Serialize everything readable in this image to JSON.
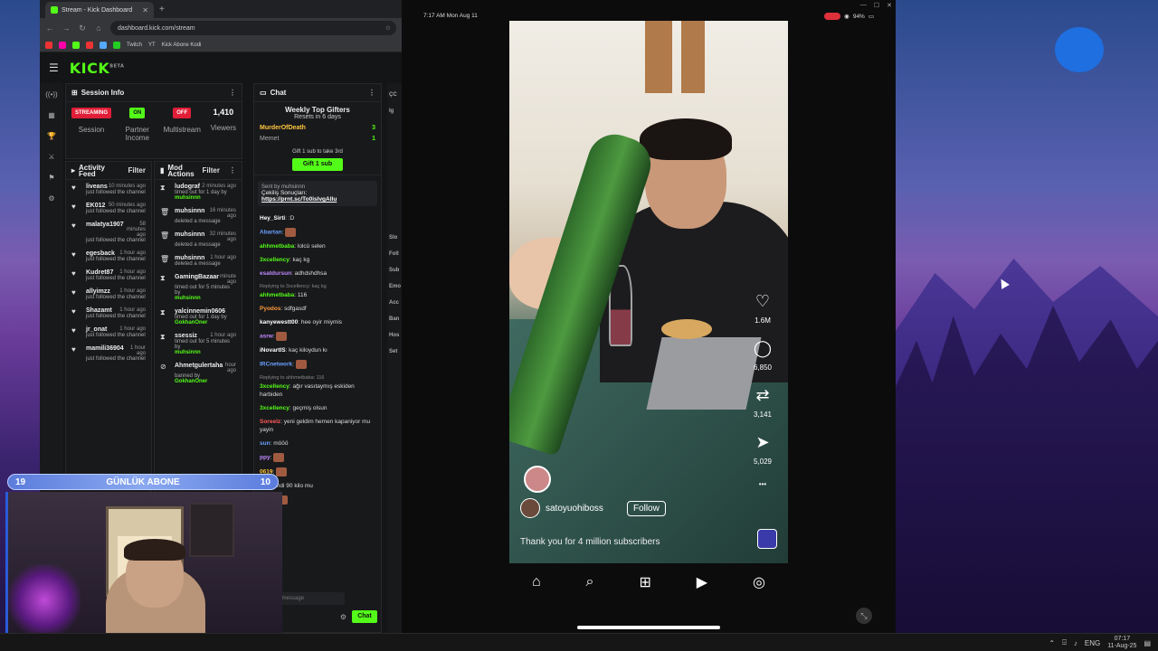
{
  "browser": {
    "tab_title": "Stream - Kick Dashboard",
    "url": "dashboard.kick.com/stream",
    "bookmarks": [
      "Twitch",
      "YT",
      "Kick Abone Kodi"
    ]
  },
  "kick": {
    "logo": "KICK",
    "logo_sup": "BETA",
    "session": {
      "title": "Session Info",
      "streaming": "STREAMING",
      "session_label": "Session",
      "partner_badge": "ON",
      "partner_label": "Partner Income",
      "multistream_badge": "OFF",
      "multistream_label": "Multistream",
      "viewers_count": "1,410",
      "viewers_label": "Viewers"
    },
    "activity": {
      "title": "Activity Feed",
      "filter": "Filter",
      "items": [
        {
          "name": "liveans",
          "time": "10 minutes ago",
          "text": "just followed the channel"
        },
        {
          "name": "EK012",
          "time": "50 minutes ago",
          "text": "just followed the channel"
        },
        {
          "name": "malatya1907",
          "time": "58 minutes ago",
          "text": "just followed the channel"
        },
        {
          "name": "egesback",
          "time": "1 hour ago",
          "text": "just followed the channel"
        },
        {
          "name": "Kudret87",
          "time": "1 hour ago",
          "text": "just followed the channel"
        },
        {
          "name": "allyimzz",
          "time": "1 hour ago",
          "text": "just followed the channel"
        },
        {
          "name": "Shazamt",
          "time": "1 hour ago",
          "text": "just followed the channel"
        },
        {
          "name": "jr_onat",
          "time": "1 hour ago",
          "text": "just followed the channel"
        },
        {
          "name": "mamili36904",
          "time": "1 hour ago",
          "text": "just followed the channel"
        }
      ]
    },
    "mod": {
      "title": "Mod Actions",
      "filter": "Filter",
      "items": [
        {
          "icon": "⧗",
          "name": "ludograf",
          "time": "2 minutes ago",
          "text": "timed out for 1 day by",
          "by": "muhsinnn"
        },
        {
          "icon": "🗑",
          "name": "muhsinnn",
          "time": "16 minutes ago",
          "text": "deleted a message",
          "by": ""
        },
        {
          "icon": "🗑",
          "name": "muhsinnn",
          "time": "32 minutes ago",
          "text": "deleted a message",
          "by": ""
        },
        {
          "icon": "🗑",
          "name": "muhsinnn",
          "time": "1 hour ago",
          "text": "deleted a message",
          "by": ""
        },
        {
          "icon": "⧗",
          "name": "GamingBazaar",
          "time": "minute ago",
          "text": "timed out for 5 minutes by",
          "by": "muhsinnn"
        },
        {
          "icon": "⧗",
          "name": "yalcinnemin0606",
          "time": "",
          "text": "timed out for 1 day by",
          "by": "GokhanOner"
        },
        {
          "icon": "⧗",
          "name": "ssessiz",
          "time": "1 hour ago",
          "text": "timed out for 5 minutes by",
          "by": "muhsinnn"
        },
        {
          "icon": "⊘",
          "name": "Ahmetgulertaha",
          "time": "hour ago",
          "text": "banned by",
          "by": "GokhanOner"
        }
      ]
    },
    "chat": {
      "title": "Chat",
      "gifters_title": "Weekly Top Gifters",
      "gifters_sub": "Resets in 6 days",
      "gifter1": "MurderOfDeath",
      "gifter1_count": "3",
      "gifter2": "Memet",
      "gifter2_count": "1",
      "gift_cta": "Gift 1 sub to take 3rd",
      "gift_btn": "Gift 1 sub",
      "pinned_by": "Sent by muhsinnn",
      "pinned_text": "Çekiliş Sonuçları:",
      "pinned_link": "https://prnt.sc/To0islvgAllu",
      "input_placeholder": "Send a message",
      "send": "Chat",
      "messages": [
        {
          "user": "Hey_Sirti",
          "color": "#ffffff",
          "text": ":D",
          "reply": ""
        },
        {
          "user": "Abartan",
          "color": "#6aa0ff",
          "text": "",
          "reply": ""
        },
        {
          "user": "ahhmetbaba",
          "color": "#53fc18",
          "text": "lolcü selen",
          "reply": ""
        },
        {
          "user": "3xcellency",
          "color": "#53fc18",
          "text": "kaç kg",
          "reply": ""
        },
        {
          "user": "esatdursun",
          "color": "#c08aff",
          "text": "adhdshdhsa",
          "reply": ""
        },
        {
          "user": "ahhmetbaba",
          "color": "#53fc18",
          "text": "116",
          "reply": "Replying to 3xcellency: kaç kg"
        },
        {
          "user": "Pyodos",
          "color": "#ff9a3c",
          "text": "sdfgasdf",
          "reply": ""
        },
        {
          "user": "kanyewestt00",
          "color": "#ffffff",
          "text": "hee oyir miymis",
          "reply": ""
        },
        {
          "user": "asrw",
          "color": "#c08aff",
          "text": "",
          "reply": ""
        },
        {
          "user": "iNovartIS",
          "color": "#ffffff",
          "text": "kaç kiloydun kı",
          "reply": ""
        },
        {
          "user": "IRCnetwork",
          "color": "#6aa0ff",
          "text": "",
          "reply": ""
        },
        {
          "user": "3xcellency",
          "color": "#53fc18",
          "text": "ağır vasıtaymış eskiden harbiden",
          "reply": "Replying to ahhmetbaba: 116"
        },
        {
          "user": "3xcellency",
          "color": "#53fc18",
          "text": "geçmiş olsun",
          "reply": ""
        },
        {
          "user": "Soreelz",
          "color": "#ff5a5a",
          "text": "yeni geldim hemen kapaniyor mu yayin",
          "reply": ""
        },
        {
          "user": "sun",
          "color": "#6aa0ff",
          "text": "mööö",
          "reply": ""
        },
        {
          "user": "ppy",
          "color": "#c08aff",
          "text": "",
          "reply": ""
        },
        {
          "user": "0619",
          "color": "#ffc53d",
          "text": "",
          "reply": ""
        },
        {
          "user": "na",
          "color": "#6aa0ff",
          "text": "Şimdi 90 kilo mu",
          "reply": ""
        },
        {
          "user": "work",
          "color": "#ffc53d",
          "text": "",
          "reply": ""
        },
        {
          "user": "",
          "color": "#aaaaaa",
          "text": "s only",
          "reply": ""
        }
      ]
    },
    "right_col": [
      "ÇC",
      "Ig",
      "Slo",
      "Foll",
      "Sub",
      "Emo",
      "Acc",
      "Ban",
      "Hos",
      "Set"
    ]
  },
  "overlay": {
    "sub_goal_left": "19",
    "sub_goal_label": "GÜNLÜK ABONE",
    "sub_goal_right": "10"
  },
  "phone": {
    "time": "7:17 AM  Mon Aug 11",
    "battery": "94%",
    "likes": "1.6M",
    "comments": "6,850",
    "reposts": "3,141",
    "shares": "5,029",
    "username": "satoyuohiboss",
    "follow": "Follow",
    "caption": "Thank you for 4 million subscribers"
  },
  "taskbar": {
    "lang": "ENG",
    "time": "07:17",
    "date": "11-Aug-25"
  }
}
